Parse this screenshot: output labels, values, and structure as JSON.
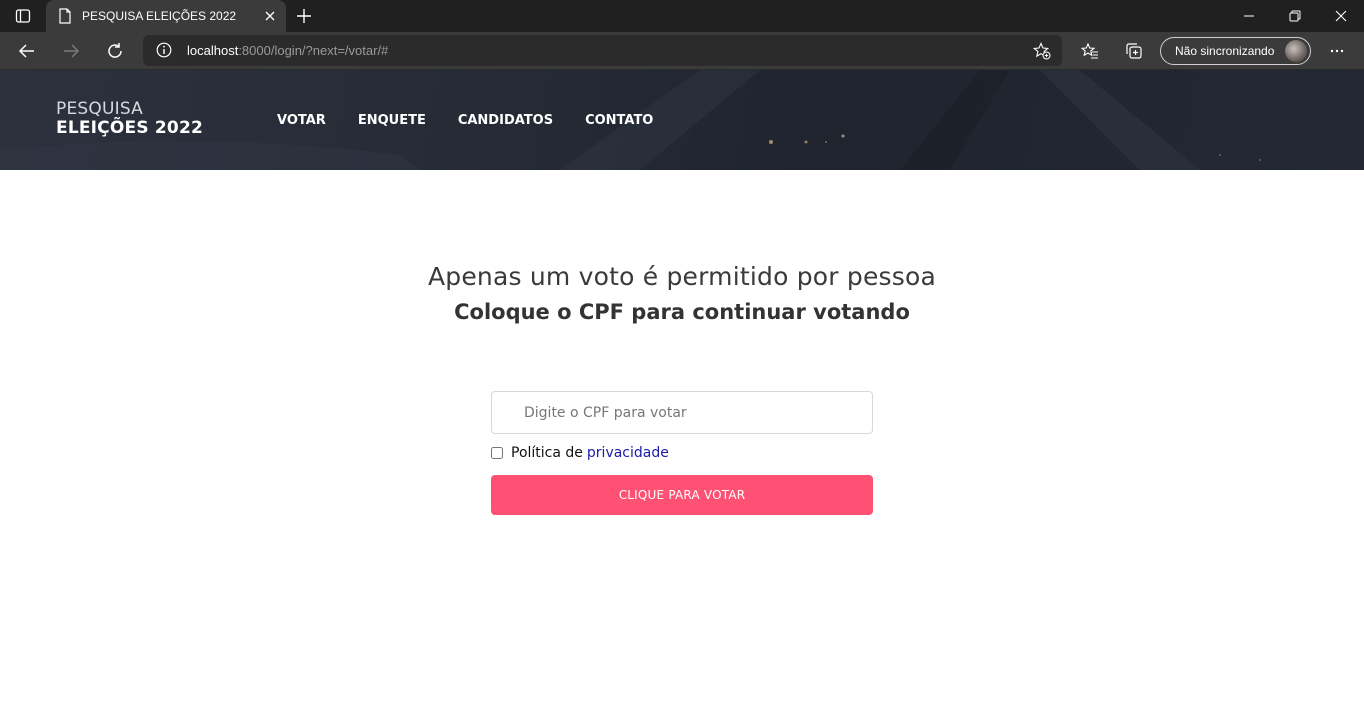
{
  "browser": {
    "tab_title": "PESQUISA ELEIÇÕES 2022",
    "address": {
      "host": "localhost",
      "rest": ":8000/login/?next=/votar/#"
    },
    "profile_label": "Não sincronizando",
    "icons": {
      "tab_actions": "tab-actions-icon",
      "page": "page-icon",
      "close": "close-icon",
      "new_tab": "plus-icon",
      "back": "back-arrow-icon",
      "forward": "forward-arrow-icon",
      "refresh": "refresh-icon",
      "info": "info-icon",
      "favorite_add": "star-add-icon",
      "favorites": "favorites-icon",
      "collections": "collections-icon",
      "more": "more-icon",
      "minimize": "minimize-icon",
      "maximize": "restore-icon",
      "window_close": "close-icon"
    }
  },
  "site": {
    "logo_line1": "PESQUISA",
    "logo_line2": "ELEIÇÕES 2022",
    "nav": [
      {
        "label": "VOTAR"
      },
      {
        "label": "ENQUETE"
      },
      {
        "label": "CANDIDATOS"
      },
      {
        "label": "CONTATO"
      }
    ],
    "header_bg": "#262b36"
  },
  "main": {
    "headline": "Apenas um voto é permitido por pessoa",
    "subheadline": "Coloque o CPF para continuar votando",
    "cpf_placeholder": "Digite o CPF para votar",
    "cpf_value": "",
    "privacy_prefix": "Política de",
    "privacy_link": "privacidade",
    "privacy_checked": false,
    "button_label": "CLIQUE PARA VOTAR",
    "button_color": "#ff5173"
  }
}
